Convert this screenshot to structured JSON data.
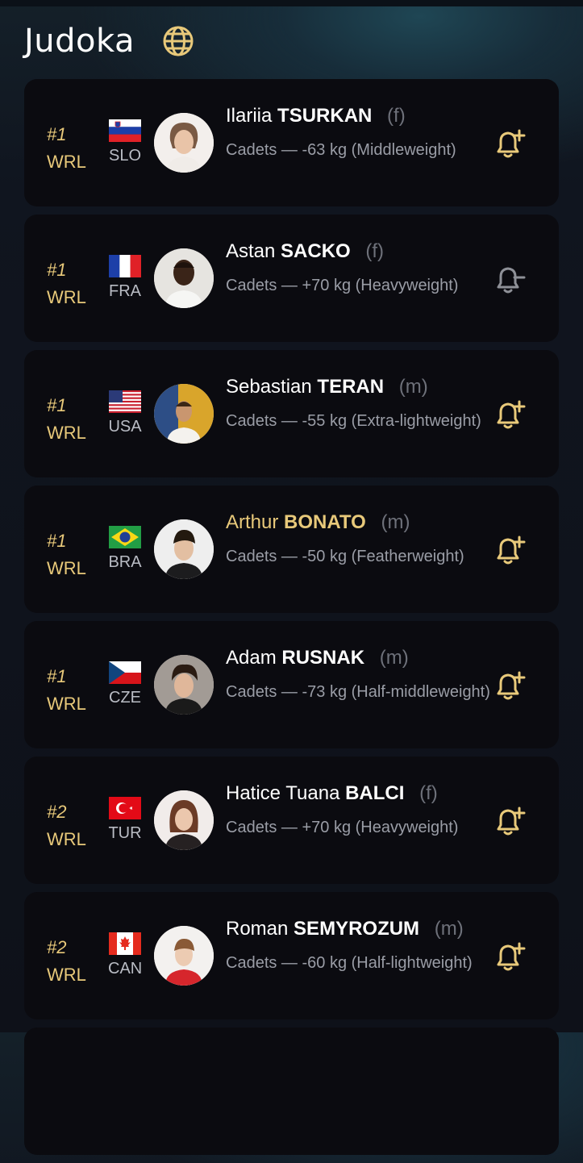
{
  "header": {
    "title": "Judoka",
    "icon": "globe-icon"
  },
  "colors": {
    "accent": "#e8c97a",
    "card_bg": "#0b0b10",
    "muted": "#9a9da6"
  },
  "athletes": [
    {
      "rank": "#1",
      "list": "WRL",
      "country": "SLO",
      "first": "Ilariia",
      "last": "TSURKAN",
      "gender": "(f)",
      "detail": "Cadets — -63 kg (Middleweight)",
      "highlight": false,
      "bell": "bell-plus-icon"
    },
    {
      "rank": "#1",
      "list": "WRL",
      "country": "FRA",
      "first": "Astan",
      "last": "SACKO",
      "gender": "(f)",
      "detail": "Cadets — +70 kg (Heavyweight)",
      "highlight": false,
      "bell": "bell-minus-icon"
    },
    {
      "rank": "#1",
      "list": "WRL",
      "country": "USA",
      "first": "Sebastian",
      "last": "TERAN",
      "gender": "(m)",
      "detail": "Cadets — -55 kg (Extra-lightweight)",
      "highlight": false,
      "bell": "bell-plus-icon"
    },
    {
      "rank": "#1",
      "list": "WRL",
      "country": "BRA",
      "first": "Arthur",
      "last": "BONATO",
      "gender": "(m)",
      "detail": "Cadets — -50 kg (Featherweight)",
      "highlight": true,
      "bell": "bell-plus-icon"
    },
    {
      "rank": "#1",
      "list": "WRL",
      "country": "CZE",
      "first": "Adam",
      "last": "RUSNAK",
      "gender": "(m)",
      "detail": "Cadets — -73 kg (Half-middleweight)",
      "highlight": false,
      "bell": "bell-plus-icon"
    },
    {
      "rank": "#2",
      "list": "WRL",
      "country": "TUR",
      "first": "Hatice Tuana",
      "last": "BALCI",
      "gender": "(f)",
      "detail": "Cadets — +70 kg (Heavyweight)",
      "highlight": false,
      "bell": "bell-plus-icon"
    },
    {
      "rank": "#2",
      "list": "WRL",
      "country": "CAN",
      "first": "Roman",
      "last": "SEMYROZUM",
      "gender": "(m)",
      "detail": "Cadets — -60 kg (Half-lightweight)",
      "highlight": false,
      "bell": "bell-plus-icon"
    }
  ]
}
